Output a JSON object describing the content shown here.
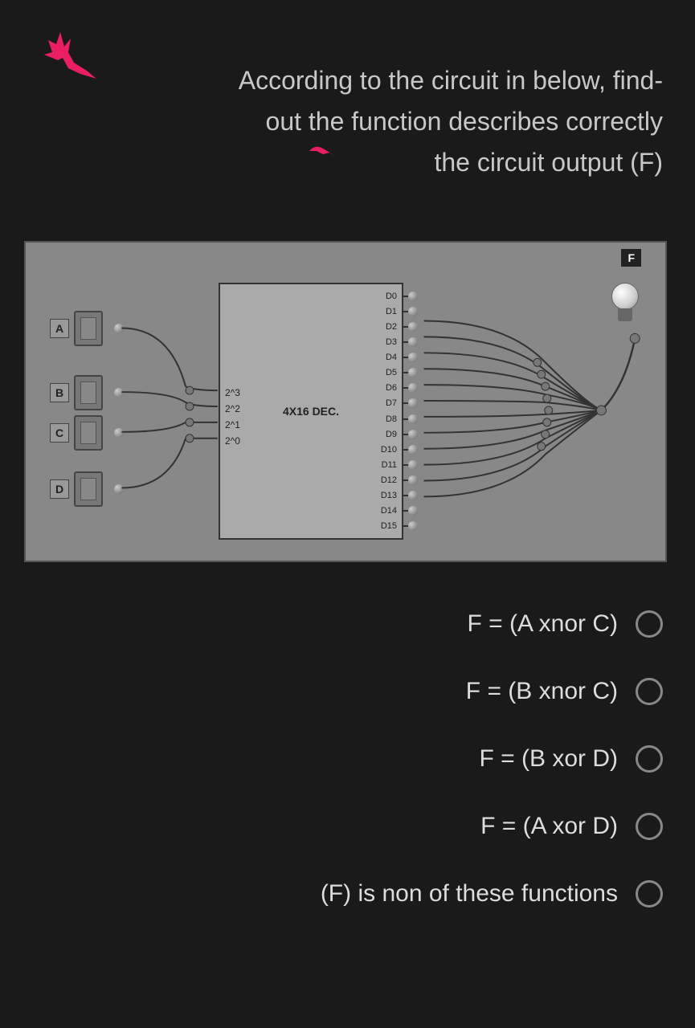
{
  "question": {
    "line1": "According to the circuit in below, find-",
    "line2": "out the function describes correctly",
    "line3": "the circuit output (F)"
  },
  "circuit": {
    "output_label": "F",
    "inputs": [
      "A",
      "B",
      "C",
      "D"
    ],
    "decoder": {
      "name": "4X16 DEC.",
      "select_pins": [
        "2^3",
        "2^2",
        "2^1",
        "2^0"
      ],
      "outputs": [
        "D0",
        "D1",
        "D2",
        "D3",
        "D4",
        "D5",
        "D6",
        "D7",
        "D8",
        "D9",
        "D10",
        "D11",
        "D12",
        "D13",
        "D14",
        "D15"
      ],
      "connected_outputs": [
        "D2",
        "D3",
        "D4",
        "D5",
        "D6",
        "D7",
        "D8",
        "D9",
        "D10",
        "D11",
        "D12",
        "D13"
      ]
    }
  },
  "options": [
    "F = (A xnor C)",
    "F = (B xnor C)",
    "F = (B xor D)",
    "F = (A xor D)",
    "(F) is non of these functions"
  ]
}
